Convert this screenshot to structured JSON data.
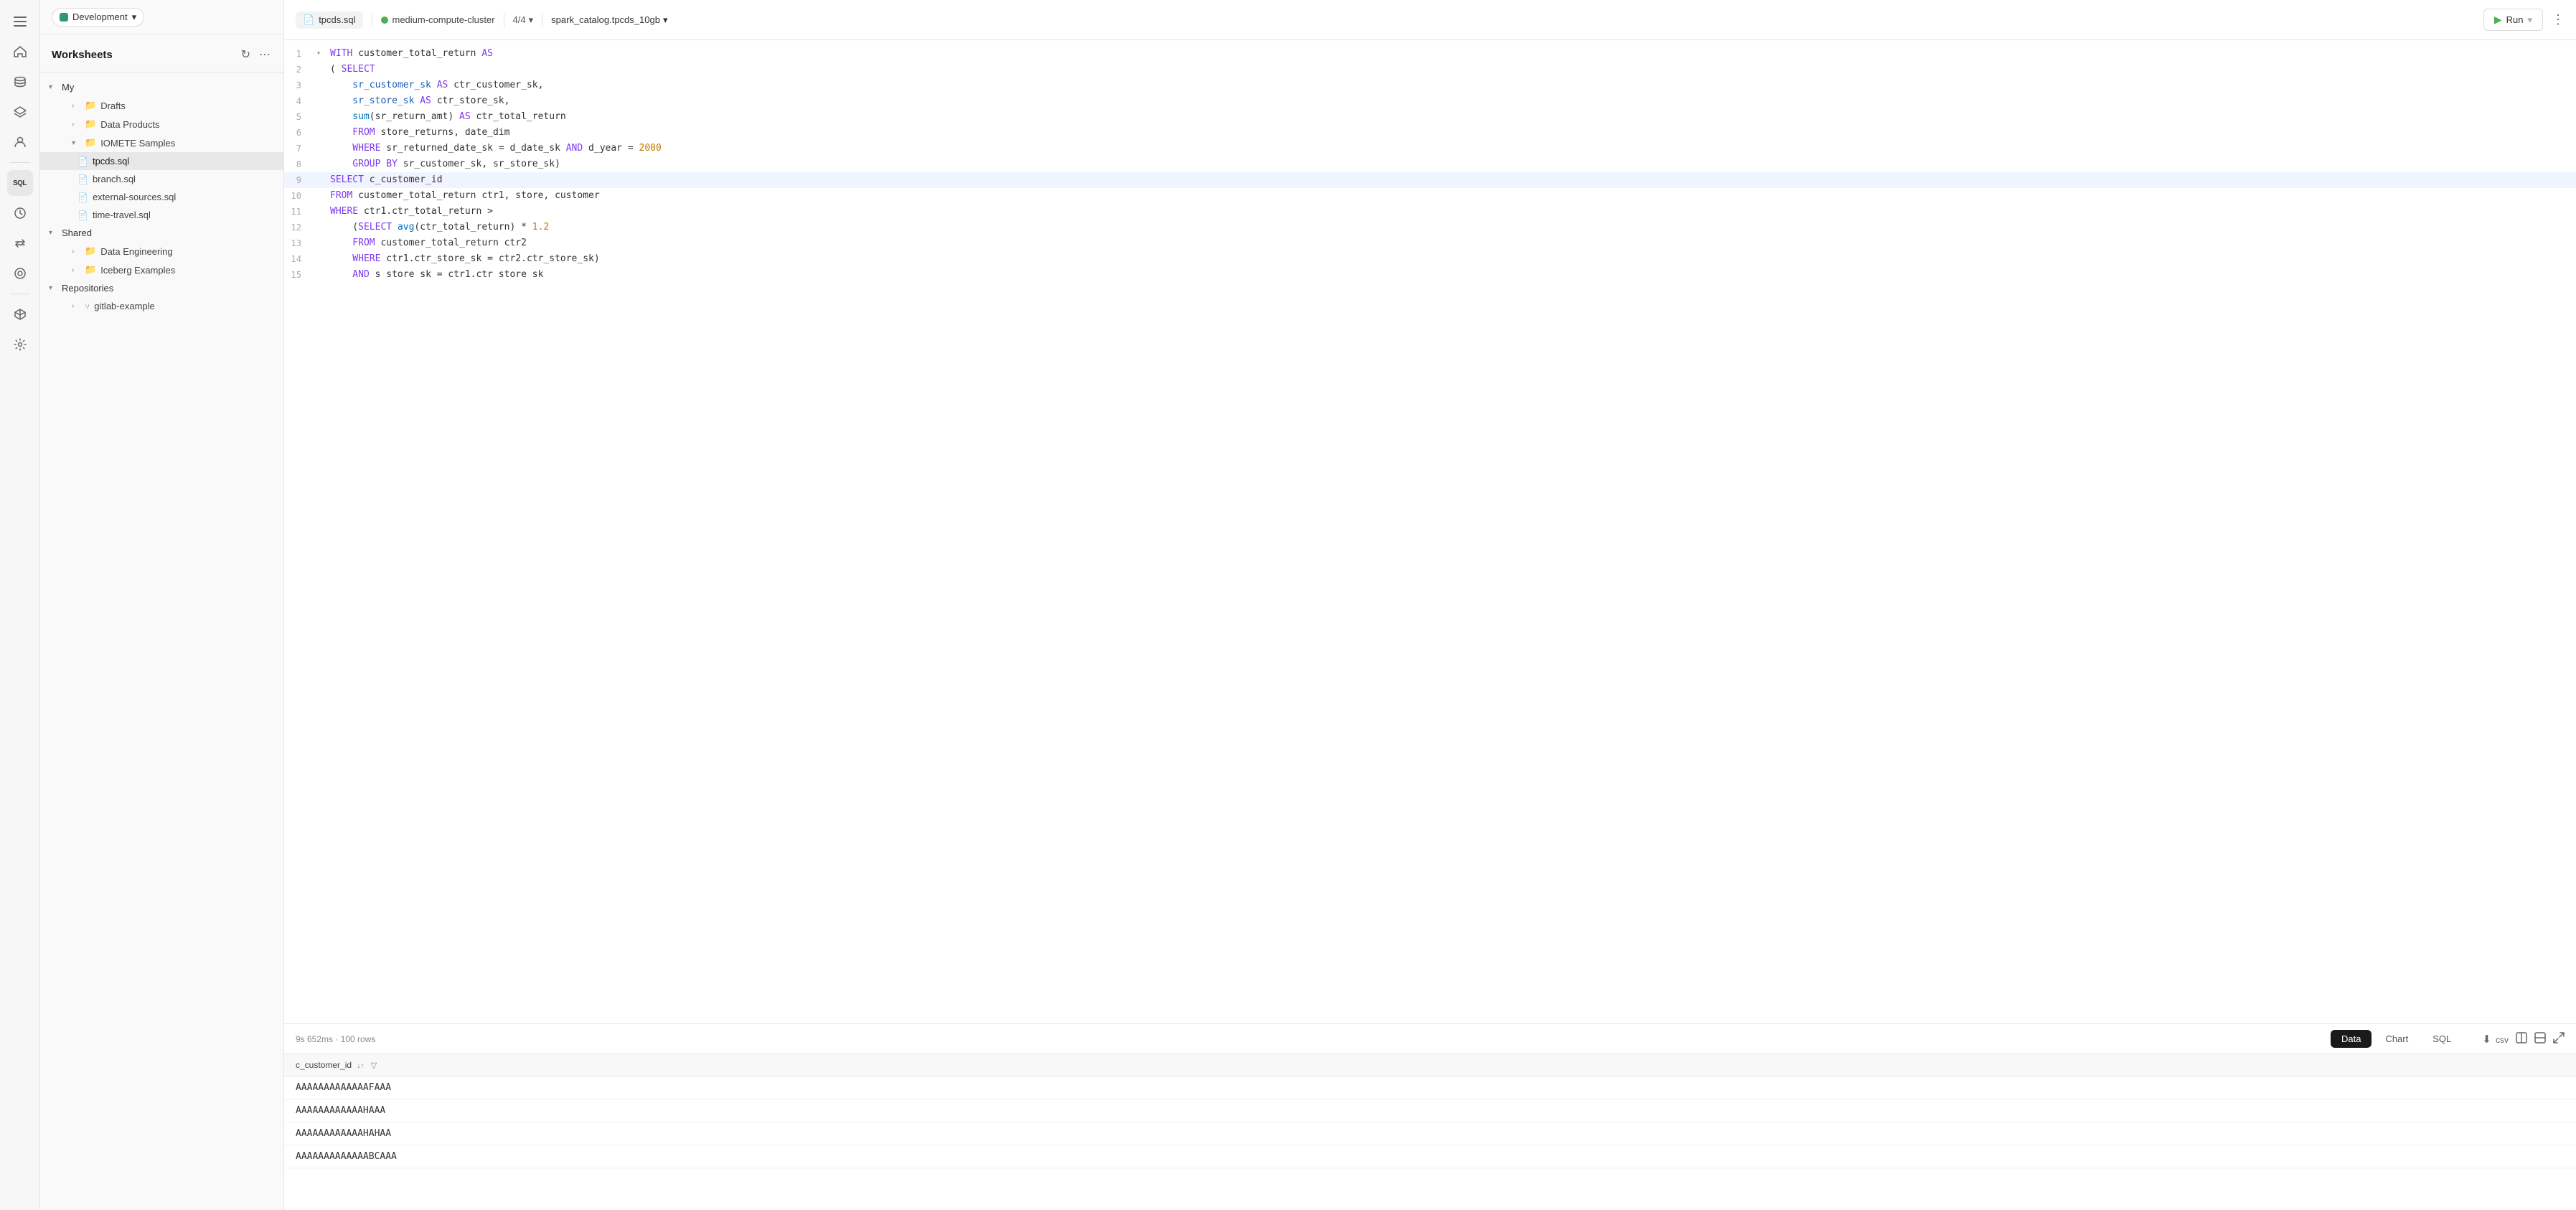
{
  "header": {
    "dev_label": "Development",
    "chevron": "▾"
  },
  "sidebar": {
    "title": "Worksheets",
    "refresh_icon": "↻",
    "more_icon": "⋯",
    "tree": {
      "my_label": "My",
      "drafts_label": "Drafts",
      "data_products_label": "Data Products",
      "iomete_samples_label": "IOMETE Samples",
      "tpcds_sql": "tpcds.sql",
      "branch_sql": "branch.sql",
      "external_sources_sql": "external-sources.sql",
      "time_travel_sql": "time-travel.sql",
      "shared_label": "Shared",
      "data_engineering_label": "Data Engineering",
      "iceberg_examples_label": "Iceberg Examples",
      "repositories_label": "Repositories",
      "gitlab_example_label": "gitlab-example"
    }
  },
  "topbar": {
    "file_tab": "tpcds.sql",
    "cluster": "medium-compute-cluster",
    "pages": "4/4",
    "catalog": "spark_catalog.tpcds_10gb",
    "run_label": "Run",
    "more_icon": "⋮"
  },
  "code": {
    "lines": [
      {
        "num": 1,
        "fold": true,
        "content": "WITH customer_total_return AS",
        "tokens": [
          {
            "t": "kw",
            "v": "WITH"
          },
          {
            "t": "plain",
            "v": " customer_total_return "
          },
          {
            "t": "kw",
            "v": "AS"
          }
        ]
      },
      {
        "num": 2,
        "fold": false,
        "content": "( SELECT",
        "tokens": [
          {
            "t": "plain",
            "v": "( "
          },
          {
            "t": "kw",
            "v": "SELECT"
          }
        ]
      },
      {
        "num": 3,
        "fold": false,
        "content": "    sr_customer_sk AS ctr_customer_sk,",
        "tokens": [
          {
            "t": "col",
            "v": "    sr_customer_sk"
          },
          {
            "t": "plain",
            "v": " "
          },
          {
            "t": "kw",
            "v": "AS"
          },
          {
            "t": "plain",
            "v": " ctr_customer_sk,"
          }
        ]
      },
      {
        "num": 4,
        "fold": false,
        "content": "    sr_store_sk AS ctr_store_sk,",
        "tokens": [
          {
            "t": "col",
            "v": "    sr_store_sk"
          },
          {
            "t": "plain",
            "v": " "
          },
          {
            "t": "kw",
            "v": "AS"
          },
          {
            "t": "plain",
            "v": " ctr_store_sk,"
          }
        ]
      },
      {
        "num": 5,
        "fold": false,
        "content": "    sum(sr_return_amt) AS ctr_total_return",
        "tokens": [
          {
            "t": "fn",
            "v": "    sum"
          },
          {
            "t": "plain",
            "v": "(sr_return_amt) "
          },
          {
            "t": "kw",
            "v": "AS"
          },
          {
            "t": "plain",
            "v": " ctr_total_return"
          }
        ]
      },
      {
        "num": 6,
        "fold": false,
        "content": "    FROM store_returns, date_dim",
        "tokens": [
          {
            "t": "kw",
            "v": "    FROM"
          },
          {
            "t": "plain",
            "v": " store_returns, date_dim"
          }
        ]
      },
      {
        "num": 7,
        "fold": false,
        "content": "    WHERE sr_returned_date_sk = d_date_sk AND d_year = 2000",
        "tokens": [
          {
            "t": "kw",
            "v": "    WHERE"
          },
          {
            "t": "plain",
            "v": " sr_returned_date_sk = d_date_sk "
          },
          {
            "t": "kw",
            "v": "AND"
          },
          {
            "t": "plain",
            "v": " d_year = "
          },
          {
            "t": "num",
            "v": "2000"
          }
        ]
      },
      {
        "num": 8,
        "fold": false,
        "content": "    GROUP BY sr_customer_sk, sr_store_sk)",
        "tokens": [
          {
            "t": "kw",
            "v": "    GROUP BY"
          },
          {
            "t": "plain",
            "v": " sr_customer_sk, sr_store_sk)"
          }
        ]
      },
      {
        "num": 9,
        "fold": false,
        "content": "SELECT c_customer_id",
        "tokens": [
          {
            "t": "kw",
            "v": "SELECT"
          },
          {
            "t": "plain",
            "v": " c_customer_id"
          }
        ],
        "highlight": true
      },
      {
        "num": 10,
        "fold": false,
        "content": "FROM customer_total_return ctr1, store, customer",
        "tokens": [
          {
            "t": "kw",
            "v": "FROM"
          },
          {
            "t": "plain",
            "v": " customer_total_return ctr1, store, customer"
          }
        ]
      },
      {
        "num": 11,
        "fold": false,
        "content": "WHERE ctr1.ctr_total_return >",
        "tokens": [
          {
            "t": "kw",
            "v": "WHERE"
          },
          {
            "t": "plain",
            "v": " ctr1.ctr_total_return >"
          }
        ]
      },
      {
        "num": 12,
        "fold": false,
        "content": "    (SELECT avg(ctr_total_return) * 1.2",
        "tokens": [
          {
            "t": "plain",
            "v": "    ("
          },
          {
            "t": "kw",
            "v": "SELECT"
          },
          {
            "t": "plain",
            "v": " "
          },
          {
            "t": "fn",
            "v": "avg"
          },
          {
            "t": "plain",
            "v": "(ctr_total_return) * "
          },
          {
            "t": "num",
            "v": "1.2"
          }
        ]
      },
      {
        "num": 13,
        "fold": false,
        "content": "    FROM customer_total_return ctr2",
        "tokens": [
          {
            "t": "kw",
            "v": "    FROM"
          },
          {
            "t": "plain",
            "v": " customer_total_return ctr2"
          }
        ]
      },
      {
        "num": 14,
        "fold": false,
        "content": "    WHERE ctr1.ctr_store_sk = ctr2.ctr_store_sk)",
        "tokens": [
          {
            "t": "kw",
            "v": "    WHERE"
          },
          {
            "t": "plain",
            "v": " ctr1.ctr_store_sk = ctr2.ctr_store_sk)"
          }
        ]
      },
      {
        "num": 15,
        "fold": false,
        "content": "    AND s store sk = ctr1.ctr store sk",
        "tokens": [
          {
            "t": "kw",
            "v": "    AND"
          },
          {
            "t": "plain",
            "v": " s store sk = ctr1.ctr store sk"
          }
        ]
      }
    ]
  },
  "results": {
    "meta": "9s 652ms · 100 rows",
    "tabs": [
      {
        "label": "Data",
        "active": true
      },
      {
        "label": "Chart",
        "active": false
      },
      {
        "label": "SQL",
        "active": false
      }
    ],
    "column": "c_customer_id",
    "sort_icon": "↓↑",
    "filter_icon": "▽",
    "rows": [
      "AAAAAAAAAAAAAFAAA",
      "AAAAAAAAAAAAHAAA",
      "AAAAAAAAAAAAHAHAA",
      "AAAAAAAAAAAAABCAAA"
    ],
    "csv_label": "csv",
    "download_icon": "⬇",
    "expand_icon": "⤢"
  },
  "icon_rail": {
    "icons": [
      {
        "name": "menu-icon",
        "symbol": "☰",
        "active": false
      },
      {
        "name": "home-icon",
        "symbol": "⌂",
        "active": false
      },
      {
        "name": "database-icon",
        "symbol": "🗄",
        "active": false
      },
      {
        "name": "catalog-icon",
        "symbol": "📋",
        "active": false
      },
      {
        "name": "profile-icon",
        "symbol": "◉",
        "active": false
      },
      {
        "name": "sql-icon",
        "symbol": "SQL",
        "active": true
      },
      {
        "name": "scheduler-icon",
        "symbol": "⏰",
        "active": false
      },
      {
        "name": "transfer-icon",
        "symbol": "⇄",
        "active": false
      },
      {
        "name": "target-icon",
        "symbol": "◎",
        "active": false
      },
      {
        "name": "monitor-icon",
        "symbol": "□",
        "active": false
      },
      {
        "name": "settings-icon",
        "symbol": "⚙",
        "active": false
      }
    ]
  }
}
